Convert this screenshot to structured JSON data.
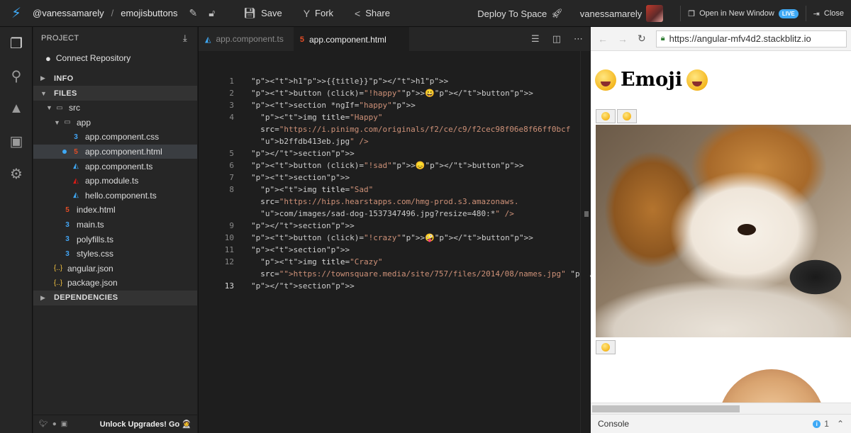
{
  "topbar": {
    "owner": "@vanessamarely",
    "separator": "/",
    "project": "emojisbuttons",
    "save_label": "Save",
    "fork_label": "Fork",
    "share_label": "Share",
    "deploy_label": "Deploy To Space",
    "username": "vanessamarely",
    "open_window_label": "Open in New Window",
    "live_badge": "LIVE",
    "close_label": "Close"
  },
  "sidebar": {
    "header": "PROJECT",
    "connect_repo": "Connect Repository",
    "sections": {
      "info": "INFO",
      "files": "FILES",
      "dependencies": "DEPENDENCIES"
    },
    "tree": [
      {
        "label": "src",
        "type": "folder",
        "depth": 1
      },
      {
        "label": "app",
        "type": "folder",
        "depth": 2
      },
      {
        "label": "app.component.css",
        "type": "css",
        "depth": 3
      },
      {
        "label": "app.component.html",
        "type": "html",
        "depth": 3,
        "selected": true
      },
      {
        "label": "app.component.ts",
        "type": "ts",
        "depth": 3
      },
      {
        "label": "app.module.ts",
        "type": "module",
        "depth": 3
      },
      {
        "label": "hello.component.ts",
        "type": "ts",
        "depth": 3
      },
      {
        "label": "index.html",
        "type": "html",
        "depth": 2
      },
      {
        "label": "main.ts",
        "type": "css",
        "depth": 2
      },
      {
        "label": "polyfills.ts",
        "type": "css",
        "depth": 2
      },
      {
        "label": "styles.css",
        "type": "css",
        "depth": 2
      },
      {
        "label": "angular.json",
        "type": "json",
        "depth": 1
      },
      {
        "label": "package.json",
        "type": "json",
        "depth": 1
      }
    ],
    "footer_label": "Unlock Upgrades! Go"
  },
  "editor": {
    "tabs": [
      {
        "label": "app.component.ts",
        "active": false
      },
      {
        "label": "app.component.html",
        "active": true
      }
    ],
    "line_numbers": [
      "1",
      "2",
      "3",
      "4",
      "",
      "5",
      "6",
      "7",
      "8",
      "",
      "9",
      "10",
      "11",
      "12",
      "13"
    ],
    "lines": [
      "<h1>{{title}}</h1>",
      "<button (click)=\"!happy\">😀</button>",
      "<section *ngIf=\"happy\">",
      "  <img title=\"Happy\"",
      "  src=\"https://i.pinimg.com/originals/f2/ce/c9/f2cec98f06e8f66ff0bcf",
      "  b2ffdb413eb.jpg\" />",
      "</section>",
      "<button (click)=\"!sad\">😞</button>",
      "<section>",
      "  <img title=\"Sad\"",
      "  src=\"https://hips.hearstapps.com/hmg-prod.s3.amazonaws.",
      "  com/images/sad-dog-1537347496.jpg?resize=480:*\" />",
      "</section>",
      "<button (click)=\"!crazy\">🤪</button>",
      "<section>",
      "  <img title=\"Crazy\"",
      "  src=\"https://townsquare.media/site/757/files/2014/08/names.jpg\" />",
      "</section>"
    ]
  },
  "preview": {
    "url": "https://angular-mfv4d2.stackblitz.io",
    "heading": "Emoji",
    "console_label": "Console",
    "info_count": "1"
  },
  "colors": {
    "accent": "#3fa9f5",
    "html": "#e44d26",
    "bg": "#1e1e1e",
    "sidebar": "#262626"
  }
}
